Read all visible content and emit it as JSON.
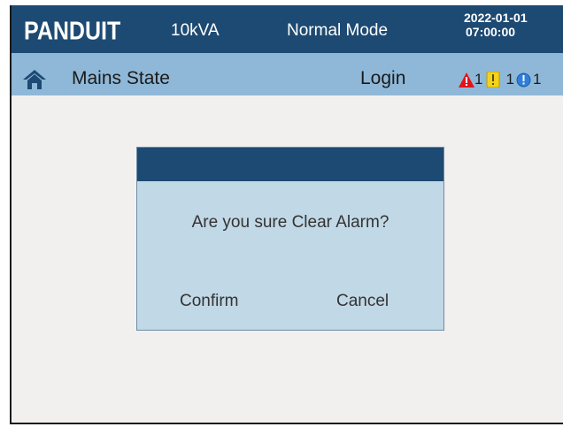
{
  "header": {
    "logo_text": "PANDUIT",
    "rating": "10kVA",
    "mode": "Normal Mode",
    "date": "2022-01-01",
    "time": "07:00:00"
  },
  "status_bar": {
    "page_title": "Mains State",
    "login_label": "Login",
    "alarms": [
      {
        "icon": "critical-alarm-icon",
        "count": "1",
        "color": "#e0141b"
      },
      {
        "icon": "warning-alarm-icon",
        "count": "1",
        "color": "#f2d21b"
      },
      {
        "icon": "info-alarm-icon",
        "count": "1",
        "color": "#2f7fd8"
      }
    ]
  },
  "dialog": {
    "message": "Are you sure Clear Alarm?",
    "confirm_label": "Confirm",
    "cancel_label": "Cancel"
  },
  "colors": {
    "header_bg": "#1d4a72",
    "status_bg": "#8fb8d8",
    "dialog_bg": "#c1d8e6",
    "screen_bg": "#f1f0ef"
  }
}
